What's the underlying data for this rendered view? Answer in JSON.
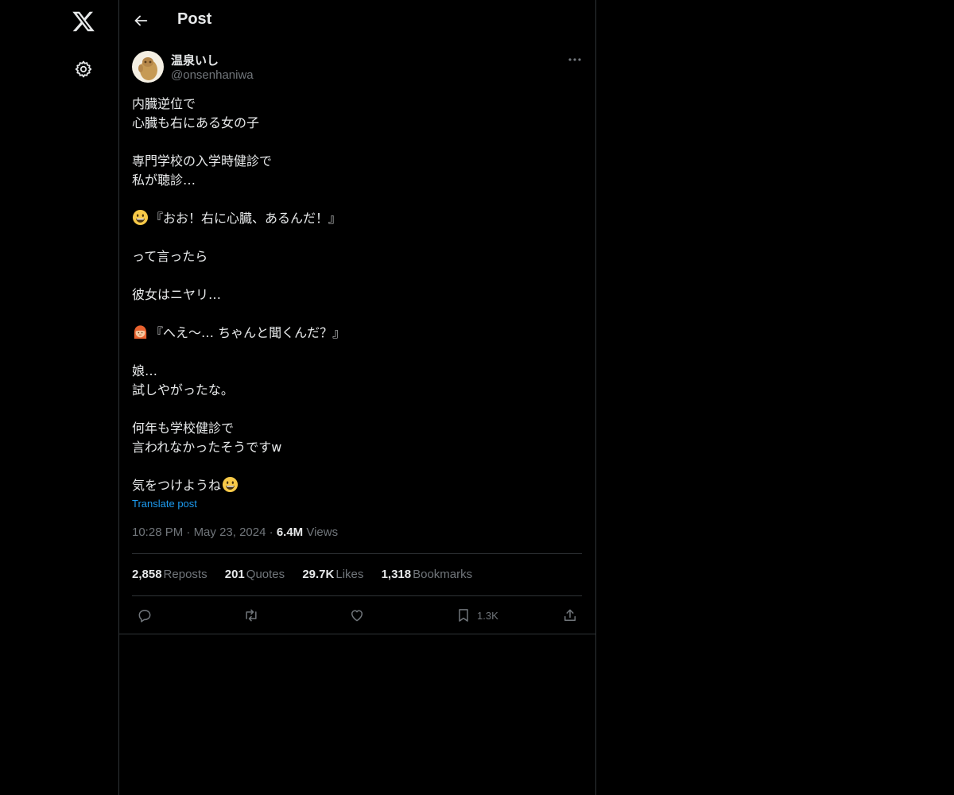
{
  "nav": {
    "logo_icon": "x-logo-icon",
    "settings_icon": "gear-icon"
  },
  "header": {
    "title": "Post",
    "back_icon": "arrow-left-icon"
  },
  "author": {
    "display_name": "温泉いし",
    "handle": "@onsenhaniwa"
  },
  "post": {
    "lines": [
      "内臓逆位で",
      "心臓も右にある女の子",
      "",
      "専門学校の入学時健診で",
      "私が聴診…",
      "",
      "『おお！右に心臓、あるんだ！』",
      "",
      "って言ったら",
      "",
      "彼女はニヤリ…",
      "",
      "『へえ〜… ちゃんと聞くんだ？』",
      "",
      "娘…",
      "試しやがったな。",
      "",
      "何年も学校健診で",
      "言われなかったそうですw",
      "",
      "気をつけようね"
    ],
    "translate_label": "Translate post",
    "time": "10:28 PM",
    "date": "May 23, 2024",
    "views_count": "6.4M",
    "views_label": "Views"
  },
  "stats": [
    {
      "count": "2,858",
      "label": "Reposts"
    },
    {
      "count": "201",
      "label": "Quotes"
    },
    {
      "count": "29.7K",
      "label": "Likes"
    },
    {
      "count": "1,318",
      "label": "Bookmarks"
    }
  ],
  "actions": {
    "reply_icon": "reply-icon",
    "repost_icon": "repost-icon",
    "like_icon": "heart-icon",
    "bookmark_icon": "bookmark-icon",
    "bookmark_count": "1.3K",
    "share_icon": "share-icon"
  },
  "colors": {
    "background": "#000000",
    "text": "#e7e9ea",
    "muted": "#71767b",
    "link": "#1d9bf0",
    "border": "#2f3336"
  }
}
